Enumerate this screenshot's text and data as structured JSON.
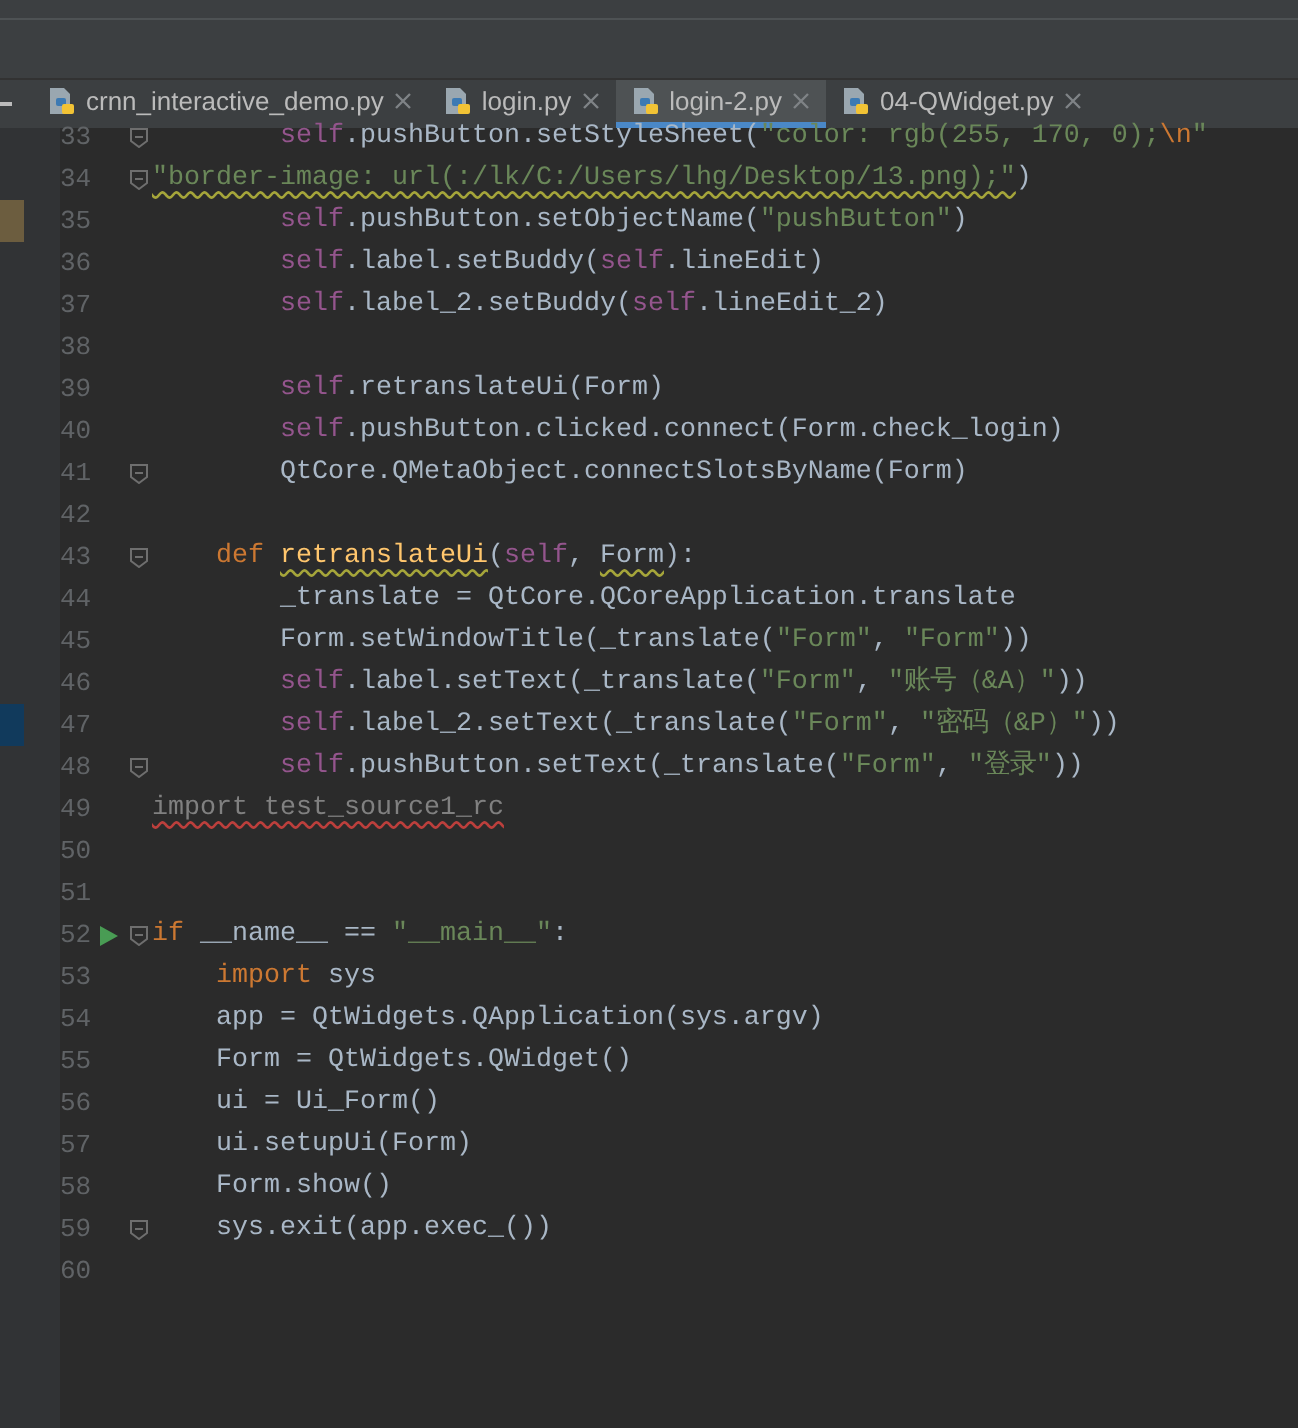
{
  "tabs": [
    {
      "label": "crnn_interactive_demo.py",
      "selected": false
    },
    {
      "label": "login.py",
      "selected": false
    },
    {
      "label": "login-2.py",
      "selected": true
    },
    {
      "label": "04-QWidget.py",
      "selected": false
    }
  ],
  "editor": {
    "lines": [
      {
        "number": "33",
        "fold": true,
        "segments": [
          {
            "kind": "self",
            "text": "        self"
          },
          {
            "kind": "plain",
            "text": ".pushButton.setStyleSheet("
          },
          {
            "kind": "str",
            "text": "\"color: rgb(255, 170, 0);"
          },
          {
            "kind": "escape",
            "text": "\\n"
          },
          {
            "kind": "str",
            "text": "\""
          }
        ]
      },
      {
        "number": "34",
        "fold": true,
        "segments": [
          {
            "kind": "str",
            "text": "\"border-image: url(:/lk/C:/Users/lhg/Desktop/13.png);\"",
            "warning": true
          },
          {
            "kind": "plain",
            "text": ")"
          }
        ]
      },
      {
        "number": "35",
        "changed": true,
        "segments": [
          {
            "kind": "self",
            "text": "        self"
          },
          {
            "kind": "plain",
            "text": ".pushButton.setObjectName("
          },
          {
            "kind": "str",
            "text": "\"pushButton\""
          },
          {
            "kind": "plain",
            "text": ")"
          }
        ]
      },
      {
        "number": "36",
        "segments": [
          {
            "kind": "self",
            "text": "        self"
          },
          {
            "kind": "plain",
            "text": ".label.setBuddy("
          },
          {
            "kind": "self",
            "text": "self"
          },
          {
            "kind": "plain",
            "text": ".lineEdit)"
          }
        ]
      },
      {
        "number": "37",
        "segments": [
          {
            "kind": "self",
            "text": "        self"
          },
          {
            "kind": "plain",
            "text": ".label_2.setBuddy("
          },
          {
            "kind": "self",
            "text": "self"
          },
          {
            "kind": "plain",
            "text": ".lineEdit_2)"
          }
        ]
      },
      {
        "number": "38"
      },
      {
        "number": "39",
        "segments": [
          {
            "kind": "self",
            "text": "        self"
          },
          {
            "kind": "plain",
            "text": ".retranslateUi(Form)"
          }
        ]
      },
      {
        "number": "40",
        "segments": [
          {
            "kind": "self",
            "text": "        self"
          },
          {
            "kind": "plain",
            "text": ".pushButton.clicked.connect(Form.check_login)"
          }
        ]
      },
      {
        "number": "41",
        "fold": true,
        "segments": [
          {
            "kind": "plain",
            "text": "        QtCore.QMetaObject.connectSlotsByName(Form)"
          }
        ]
      },
      {
        "number": "42"
      },
      {
        "number": "43",
        "fold": true,
        "segments": [
          {
            "kind": "kw",
            "text": "    def "
          },
          {
            "kind": "fn",
            "text": "retranslateUi",
            "warning": true
          },
          {
            "kind": "plain",
            "text": "("
          },
          {
            "kind": "self",
            "text": "self"
          },
          {
            "kind": "plain",
            "text": ", "
          },
          {
            "kind": "plain",
            "text": "Form",
            "warning": true
          },
          {
            "kind": "plain",
            "text": "):"
          }
        ]
      },
      {
        "number": "44",
        "segments": [
          {
            "kind": "plain",
            "text": "        _translate = QtCore.QCoreApplication.translate"
          }
        ]
      },
      {
        "number": "45",
        "segments": [
          {
            "kind": "plain",
            "text": "        Form.setWindowTitle(_translate("
          },
          {
            "kind": "str",
            "text": "\"Form\""
          },
          {
            "kind": "plain",
            "text": ", "
          },
          {
            "kind": "str",
            "text": "\"Form\""
          },
          {
            "kind": "plain",
            "text": "))"
          }
        ]
      },
      {
        "number": "46",
        "segments": [
          {
            "kind": "self",
            "text": "        self"
          },
          {
            "kind": "plain",
            "text": ".label.setText(_translate("
          },
          {
            "kind": "str",
            "text": "\"Form\""
          },
          {
            "kind": "plain",
            "text": ", "
          },
          {
            "kind": "str",
            "text": "\"账号（&A）\""
          },
          {
            "kind": "plain",
            "text": "))"
          }
        ]
      },
      {
        "number": "47",
        "bookmarked": true,
        "segments": [
          {
            "kind": "self",
            "text": "        self"
          },
          {
            "kind": "plain",
            "text": ".label_2.setText(_translate("
          },
          {
            "kind": "str",
            "text": "\"Form\""
          },
          {
            "kind": "plain",
            "text": ", "
          },
          {
            "kind": "str",
            "text": "\"密码（&P）\""
          },
          {
            "kind": "plain",
            "text": "))"
          }
        ]
      },
      {
        "number": "48",
        "fold": true,
        "segments": [
          {
            "kind": "self",
            "text": "        self"
          },
          {
            "kind": "plain",
            "text": ".pushButton.setText(_translate("
          },
          {
            "kind": "str",
            "text": "\"Form\""
          },
          {
            "kind": "plain",
            "text": ", "
          },
          {
            "kind": "str",
            "text": "\"登录\""
          },
          {
            "kind": "plain",
            "text": "))"
          }
        ]
      },
      {
        "number": "49",
        "segments": [
          {
            "kind": "unused",
            "text": "import test_source1_rc",
            "error": true
          }
        ]
      },
      {
        "number": "50"
      },
      {
        "number": "51"
      },
      {
        "number": "52",
        "fold": true,
        "run": true,
        "segments": [
          {
            "kind": "kw",
            "text": "if"
          },
          {
            "kind": "plain",
            "text": " __name__ == "
          },
          {
            "kind": "str",
            "text": "\"__main__\""
          },
          {
            "kind": "plain",
            "text": ":"
          }
        ]
      },
      {
        "number": "53",
        "segments": [
          {
            "kind": "kw",
            "text": "    import"
          },
          {
            "kind": "plain",
            "text": " sys"
          }
        ]
      },
      {
        "number": "54",
        "segments": [
          {
            "kind": "plain",
            "text": "    app = QtWidgets.QApplication(sys.argv)"
          }
        ]
      },
      {
        "number": "55",
        "segments": [
          {
            "kind": "plain",
            "text": "    Form = QtWidgets.QWidget()"
          }
        ]
      },
      {
        "number": "56",
        "segments": [
          {
            "kind": "plain",
            "text": "    ui = Ui_Form()"
          }
        ]
      },
      {
        "number": "57",
        "segments": [
          {
            "kind": "plain",
            "text": "    ui.setupUi(Form)"
          }
        ]
      },
      {
        "number": "58",
        "segments": [
          {
            "kind": "plain",
            "text": "    Form.show()"
          }
        ]
      },
      {
        "number": "59",
        "fold": true,
        "segments": [
          {
            "kind": "plain",
            "text": "    sys.exit(app.exec_())"
          }
        ]
      },
      {
        "number": "60"
      }
    ]
  }
}
